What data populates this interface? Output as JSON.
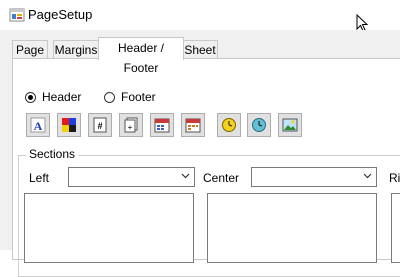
{
  "window": {
    "title": "PageSetup"
  },
  "tabs": [
    {
      "label": "Page",
      "active": false
    },
    {
      "label": "Margins",
      "active": false
    },
    {
      "label": "Header / Footer",
      "active": true
    },
    {
      "label": "Sheet",
      "active": false
    }
  ],
  "radios": {
    "header": {
      "label": "Header",
      "checked": true
    },
    "footer": {
      "label": "Footer",
      "checked": false
    }
  },
  "toolbar": {
    "buttons": [
      "font",
      "color",
      "page-number",
      "page-count",
      "date",
      "time",
      "file-path",
      "file-name",
      "image"
    ]
  },
  "sections": {
    "title": "Sections",
    "left": {
      "label": "Left",
      "value": ""
    },
    "center": {
      "label": "Center",
      "value": ""
    },
    "right": {
      "label": "Ri"
    }
  },
  "colors": {
    "accent": "#0078d7",
    "tab_border": "#c8c8c8",
    "client_bg": "#f0f0f0"
  }
}
